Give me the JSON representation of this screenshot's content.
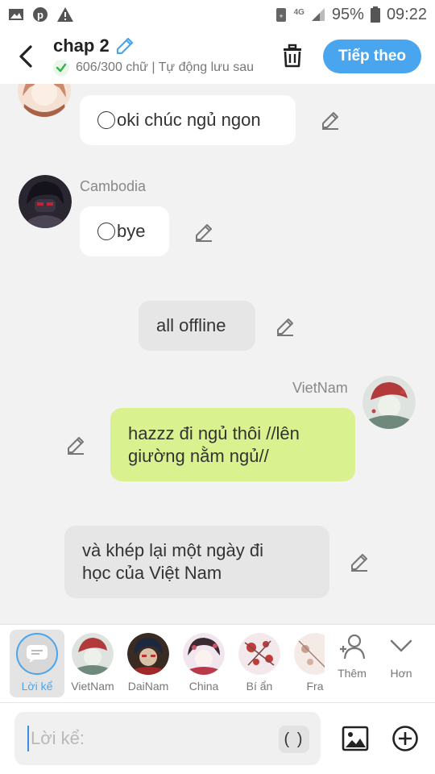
{
  "status_bar": {
    "battery": "95%",
    "time": "09:22",
    "network": "4G"
  },
  "header": {
    "title": "chap 2",
    "subtitle": "606/300 chữ | Tự động lưu sau",
    "next_label": "Tiếp theo"
  },
  "messages": [
    {
      "text": "oki chúc ngủ ngon"
    },
    {
      "speaker": "Cambodia",
      "text": "bye"
    },
    {
      "text": "all offline"
    },
    {
      "speaker": "VietNam",
      "line1": "hazzz đi ngủ thôi //lên",
      "line2": "giường nằm ngủ//"
    },
    {
      "line1": "và khép lại một ngày đi",
      "line2": "học của Việt Nam"
    }
  ],
  "characters": [
    {
      "label": "Lời kể"
    },
    {
      "label": "VietNam"
    },
    {
      "label": "DaiNam"
    },
    {
      "label": "China"
    },
    {
      "label": "Bí ẩn"
    },
    {
      "label": "Fra"
    }
  ],
  "actions": {
    "add_label": "Thêm",
    "more_label": "Hơn"
  },
  "composer": {
    "placeholder": "Lời kể:",
    "paren_label": "( )"
  },
  "colors": {
    "accent": "#4aa5ef",
    "green_bubble": "#d9f28f",
    "grey_bubble": "#e6e6e6"
  }
}
